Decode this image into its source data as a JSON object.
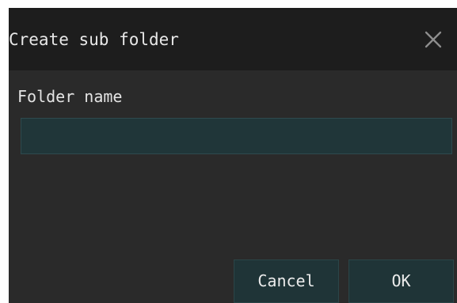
{
  "dialog": {
    "title": "Create sub folder",
    "close_icon": "close-icon",
    "field": {
      "label": "Folder name",
      "value": "",
      "placeholder": ""
    },
    "buttons": {
      "cancel_label": "Cancel",
      "ok_label": "OK"
    },
    "colors": {
      "title_bar": "#1d1d1d",
      "body": "#2a2a2a",
      "input_background": "#203639",
      "button_background": "#1f3437",
      "text": "#e8e8e8"
    }
  }
}
